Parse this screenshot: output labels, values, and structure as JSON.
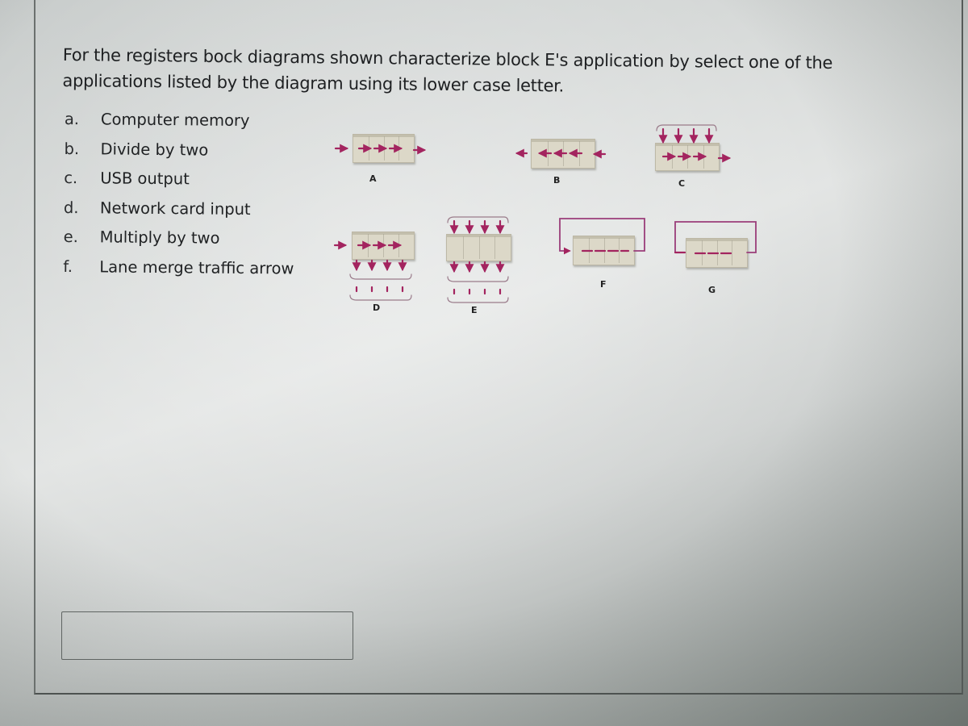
{
  "question": {
    "line1": "For the registers bock diagrams shown characterize block E's application by select one of the",
    "line2": "applications listed by the diagram using its lower case letter."
  },
  "options": [
    {
      "letter": "a.",
      "label": "Computer memory"
    },
    {
      "letter": "b.",
      "label": "Divide by two"
    },
    {
      "letter": "c.",
      "label": "USB output"
    },
    {
      "letter": "d.",
      "label": "Network card input"
    },
    {
      "letter": "e.",
      "label": "Multiply by two"
    },
    {
      "letter": "f.",
      "label": "Lane merge traffic arrow"
    }
  ],
  "diagrams": {
    "A": {
      "label": "A",
      "type": "serial-in serial-out, shift right"
    },
    "B": {
      "label": "B",
      "type": "serial-in serial-out, shift left"
    },
    "C": {
      "label": "C",
      "type": "parallel-in serial-out"
    },
    "D": {
      "label": "D",
      "type": "serial-in parallel-out"
    },
    "E": {
      "label": "E",
      "type": "parallel-in parallel-out"
    },
    "F": {
      "label": "F",
      "type": "rotate left (loop)"
    },
    "G": {
      "label": "G",
      "type": "rotate right (loop)"
    }
  },
  "answer": {
    "value": "",
    "placeholder": ""
  },
  "colors": {
    "arrow": "#a3245f",
    "loop": "#9a3d7a",
    "block": "#dcd8c8"
  }
}
